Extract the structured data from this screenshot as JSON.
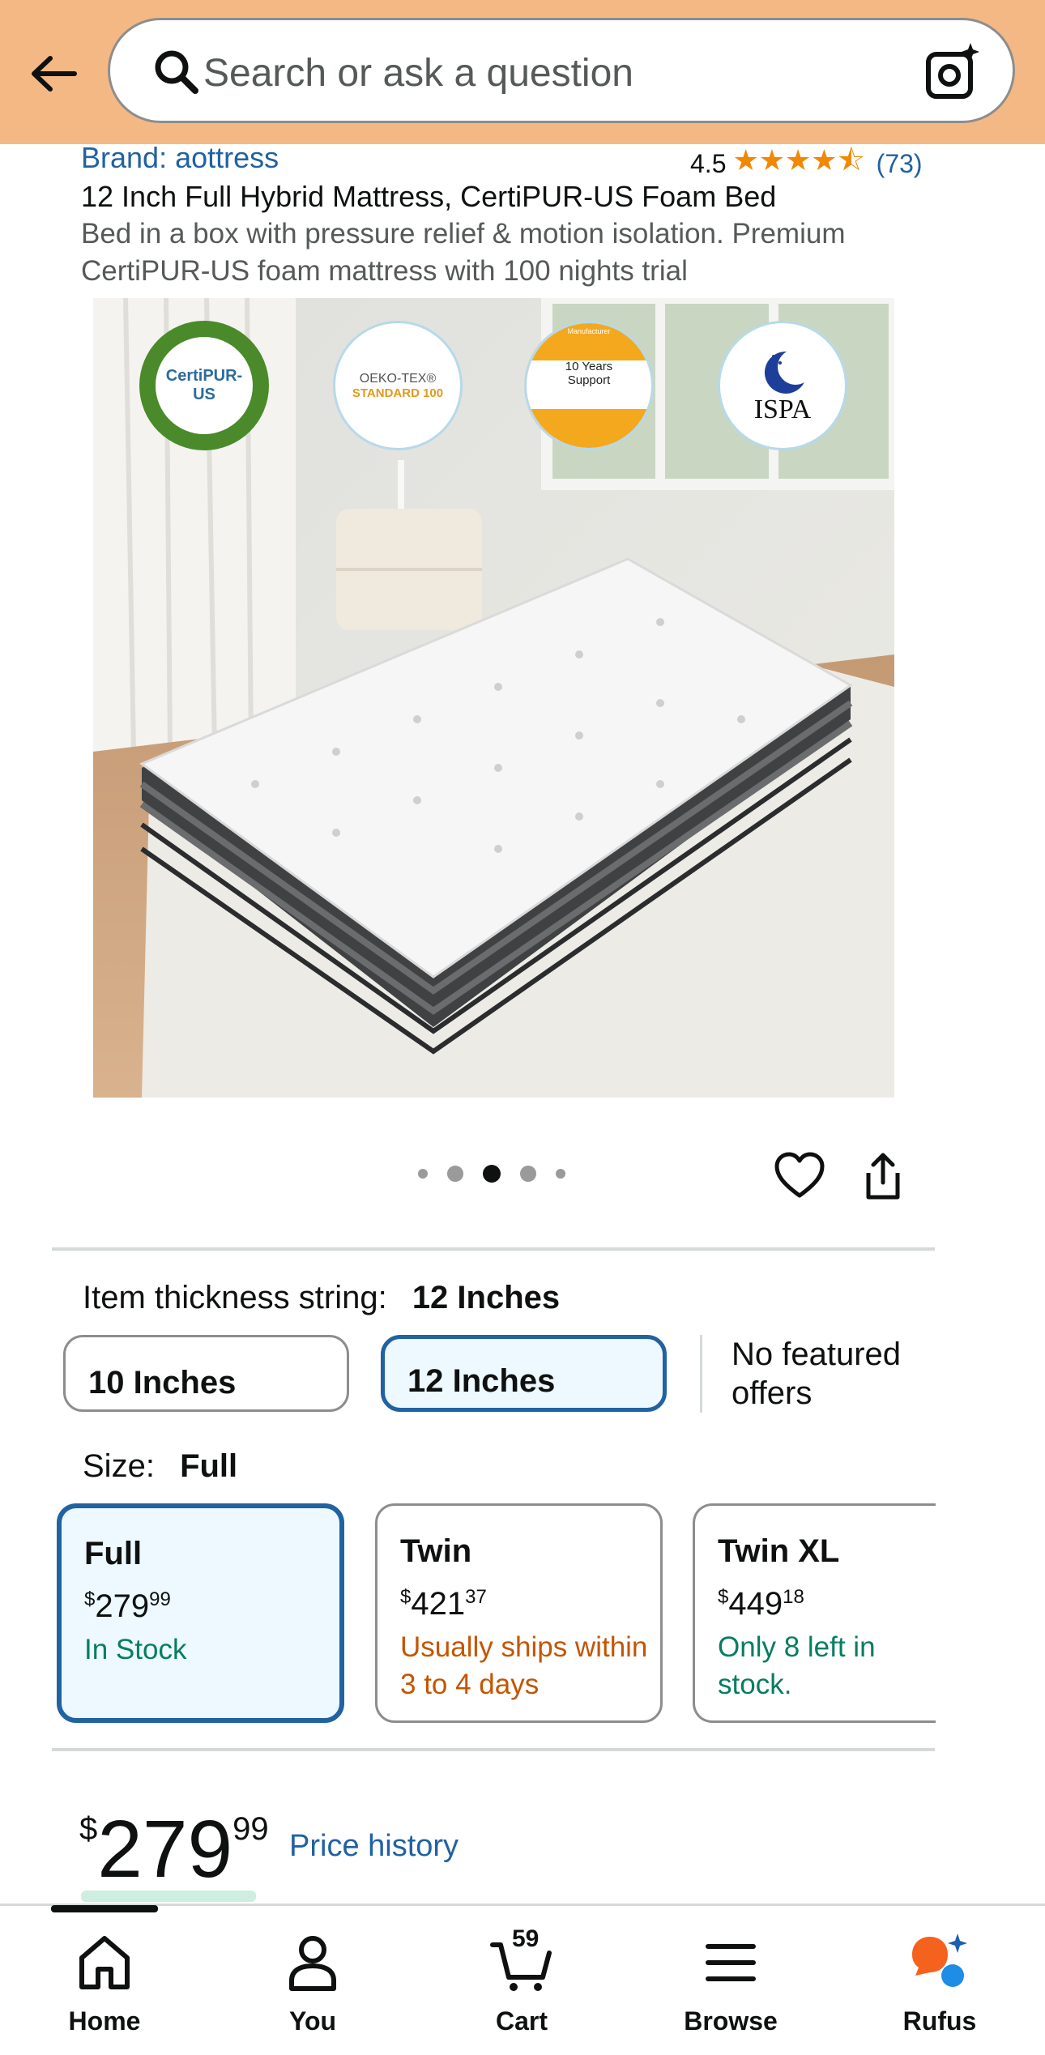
{
  "header": {
    "search_placeholder": "Search or ask a question"
  },
  "product": {
    "brand": "Brand: aottress",
    "rating": "4.5",
    "stars": "★★★★⯪",
    "rating_count": "(73)",
    "title": "12 Inch Full Hybrid Mattress, CertiPUR-US Foam Bed",
    "subtitle": "Bed in a box with pressure relief & motion isolation. Premium CertiPUR-US foam mattress with 100 nights trial"
  },
  "image_badges": {
    "certipur": "CertiPUR-US",
    "oeko_line1": "OEKO-TEX®",
    "oeko_line2": "STANDARD 100",
    "support_top": "Manufacturer",
    "support_line1": "10 Years",
    "support_line2": "Support",
    "ispa": "ISPA"
  },
  "carousel": {
    "count": 5,
    "active_index": 2
  },
  "thickness": {
    "label": "Item thickness string:",
    "selected": "12 Inches",
    "options": [
      "10 Inches",
      "12 Inches"
    ],
    "no_offers": "No featured offers"
  },
  "size": {
    "label": "Size:",
    "selected": "Full",
    "options": [
      {
        "name": "Full",
        "currency": "$",
        "price_whole": "279",
        "price_frac": "99",
        "availability": "In Stock"
      },
      {
        "name": "Twin",
        "currency": "$",
        "price_whole": "421",
        "price_frac": "37",
        "availability": "Usually ships within 3 to 4 days"
      },
      {
        "name": "Twin XL",
        "currency": "$",
        "price_whole": "449",
        "price_frac": "18",
        "availability": "Only 8 left in stock."
      }
    ]
  },
  "price": {
    "currency": "$",
    "whole": "279",
    "fraction": "99",
    "history_link": "Price history"
  },
  "nav": {
    "home": "Home",
    "you": "You",
    "cart": "Cart",
    "cart_count": "59",
    "browse": "Browse",
    "rufus": "Rufus"
  },
  "colors": {
    "header_bg": "#f4b884",
    "link": "#2162a1",
    "star": "#f08804",
    "in_stock": "#067d62",
    "ships_later": "#c45500",
    "rufus_orange": "#f5621d",
    "rufus_blue": "#1f8ce6"
  }
}
